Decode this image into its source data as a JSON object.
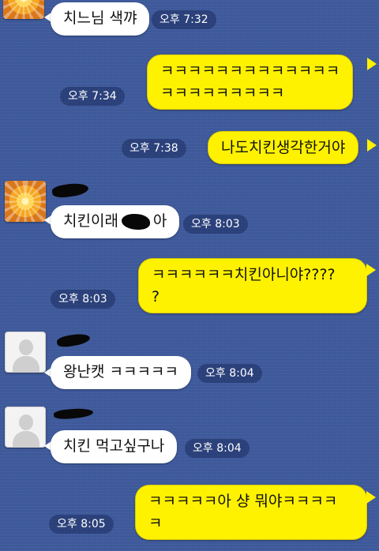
{
  "chat": {
    "messages": [
      {
        "side": "left",
        "lines": [
          "치느님 색꺄"
        ],
        "time": "오후 7:32"
      },
      {
        "side": "right",
        "lines": [
          "ㅋㅋㅋㅋㅋㅋㅋㅋㅋㅋㅋㅋㅋ",
          "ㅋㅋㅋㅋㅋㅋㅋㅋㅋ"
        ],
        "time": "오후 7:34"
      },
      {
        "side": "right",
        "lines": [
          "나도치킨생각한거야"
        ],
        "time": "오후 7:38"
      },
      {
        "side": "left",
        "lines": [
          "치킨이래",
          "아"
        ],
        "time": "오후 8:03"
      },
      {
        "side": "right",
        "lines": [
          "ㅋㅋㅋㅋㅋㅋ치킨아니야????",
          "?"
        ],
        "time": "오후 8:03"
      },
      {
        "side": "left",
        "lines": [
          "왕난캣 ㅋㅋㅋㅋㅋ"
        ],
        "time": "오후 8:04"
      },
      {
        "side": "left",
        "lines": [
          "치킨 먹고싶구나"
        ],
        "time": "오후 8:04"
      },
      {
        "side": "right",
        "lines": [
          "ㅋㅋㅋㅋㅋ아 샹 뭐야ㅋㅋㅋㅋ",
          "ㅋ"
        ],
        "time": "오후 8:05"
      }
    ]
  },
  "colors": {
    "background": "#3f5a9c",
    "my_bubble": "#fff200",
    "friend_bubble": "#ffffff",
    "timestamp_pill": "rgba(20,35,85,0.45)"
  },
  "icons": {
    "avatar_sun": "sun-avatar-icon",
    "avatar_default": "default-person-icon"
  }
}
